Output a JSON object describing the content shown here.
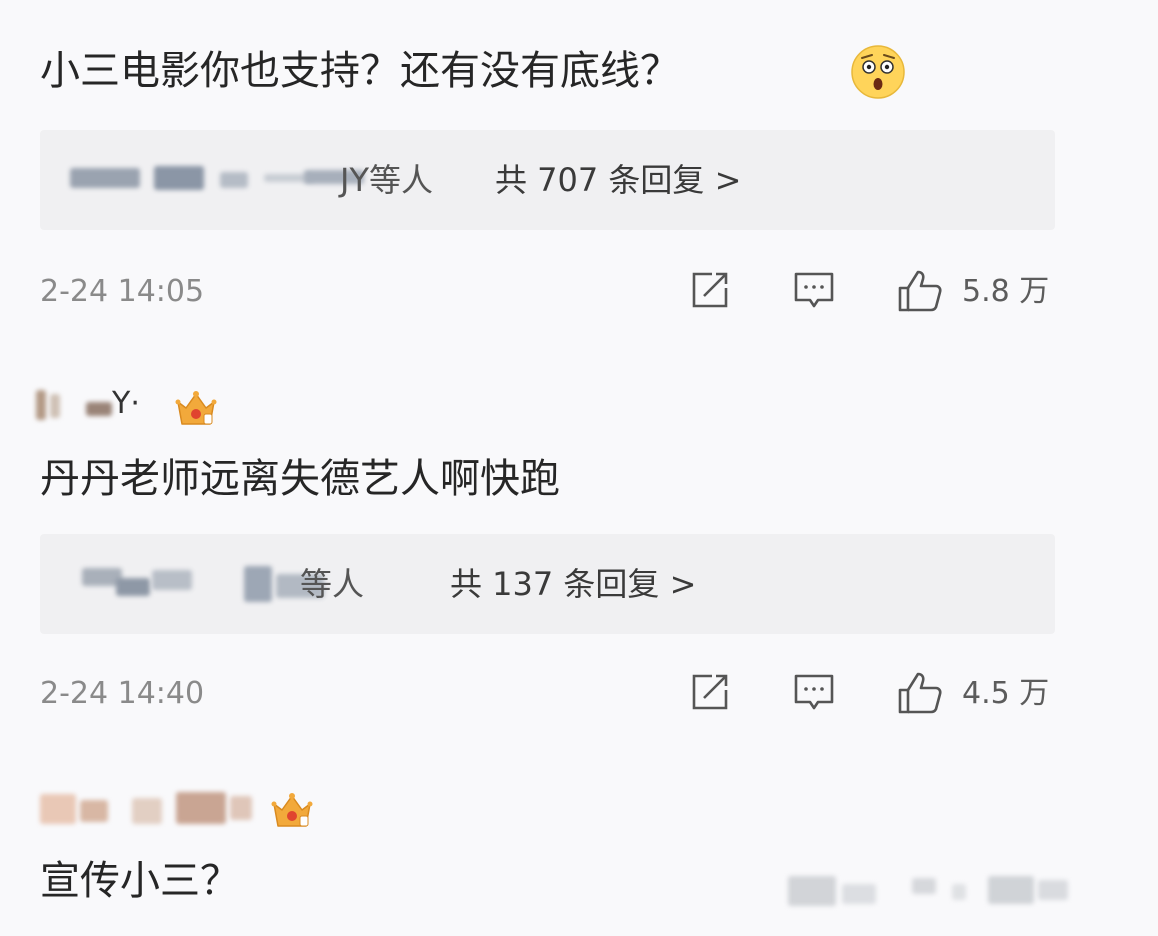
{
  "comments": [
    {
      "text": "小三电影你也支持？还有没有底线？",
      "emoji": "astonished-face-emoji",
      "replies_names_visible": "JY等人",
      "replies_count_label": "共 707 条回复 >",
      "timestamp": "2-24 14:05",
      "likes": "5.8 万"
    },
    {
      "username_suffix": "Y·",
      "badge": "crown-icon",
      "text": "丹丹老师远离失德艺人啊快跑",
      "replies_names_visible": "等人",
      "replies_count_label": "共 137 条回复 >",
      "timestamp": "2-24 14:40",
      "likes": "4.5 万"
    },
    {
      "badge": "crown-icon",
      "text": "宣传小三？"
    }
  ],
  "icons": {
    "share": "share-icon",
    "comment": "comment-icon",
    "like": "thumbs-up-icon"
  },
  "colors": {
    "background": "#f9f9fb",
    "reply_box": "#f0f0f2",
    "crown": "#f2a93b"
  }
}
